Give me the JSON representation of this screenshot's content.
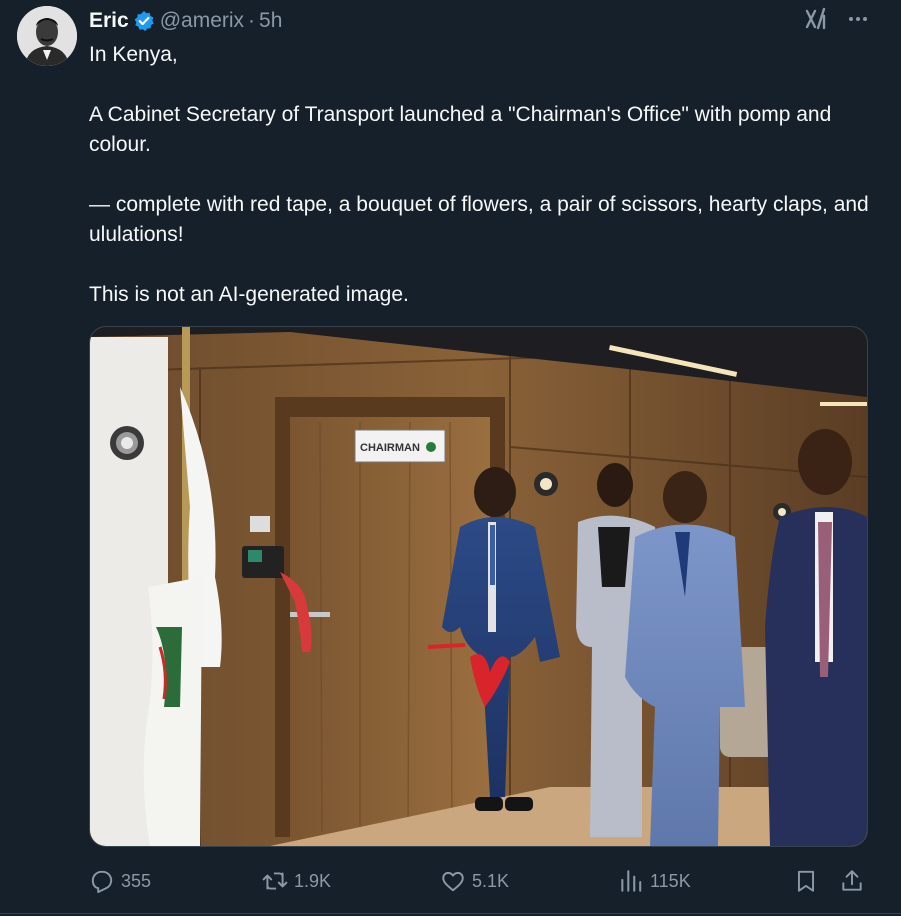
{
  "author": {
    "name": "Eric",
    "handle": "@amerix",
    "separator": "·",
    "time": "5h",
    "verified": true
  },
  "tweet": {
    "paragraphs": [
      "In Kenya,",
      "A Cabinet Secretary of Transport launched a \"Chairman's Office\" with pomp and colour.",
      "— complete with red tape, a bouquet of flowers, a pair of scissors, hearty claps, and ululations!",
      "This is not an AI-generated image."
    ]
  },
  "media": {
    "door_sign": "CHAIRMAN"
  },
  "stats": {
    "replies": "355",
    "retweets": "1.9K",
    "likes": "5.1K",
    "views": "115K"
  },
  "colors": {
    "background": "#15202b",
    "text": "#f7f9f9",
    "muted": "#8b98a5",
    "verified_badge": "#1d9bf0",
    "border": "#38444d"
  },
  "icons": {
    "reply": "reply-icon",
    "retweet": "retweet-icon",
    "like": "heart-icon",
    "views": "views-icon",
    "bookmark": "bookmark-icon",
    "share": "share-icon",
    "grok": "grok-icon",
    "more": "more-icon"
  }
}
